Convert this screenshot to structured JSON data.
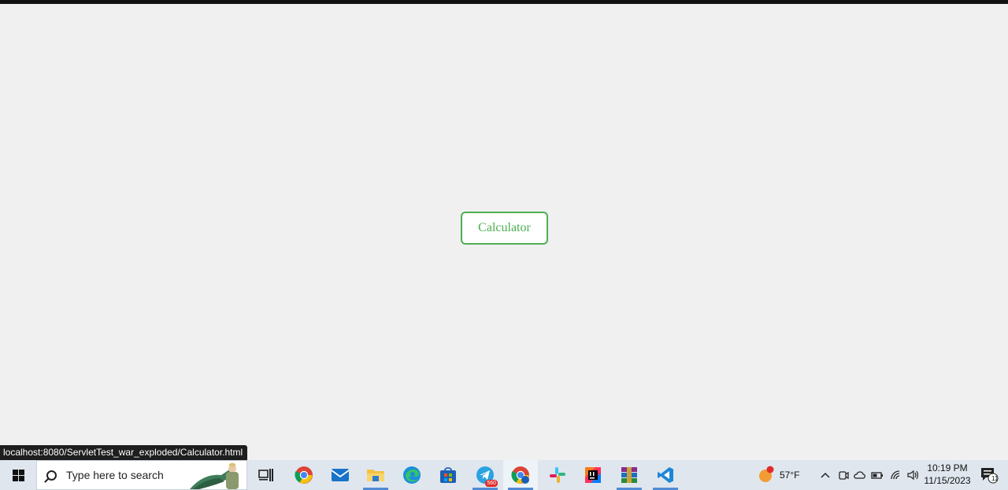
{
  "page": {
    "calculator_button": "Calculator"
  },
  "status_bar": {
    "url": "localhost:8080/ServletTest_war_exploded/Calculator.html"
  },
  "taskbar": {
    "search_placeholder": "Type here to search",
    "telegram_badge": "560",
    "weather_temp": "57°F",
    "weather_alert_count": "1",
    "time": "10:19 PM",
    "date": "11/15/2023",
    "notification_count": "11",
    "accent_color": "#4caf50",
    "pinned_apps": [
      "task-view-icon",
      "chrome-icon",
      "mail-icon",
      "file-explorer-icon",
      "edge-icon",
      "microsoft-store-icon",
      "telegram-icon",
      "chrome-profile-icon",
      "slack-icon",
      "intellij-icon",
      "winrar-icon",
      "vscode-icon"
    ]
  }
}
